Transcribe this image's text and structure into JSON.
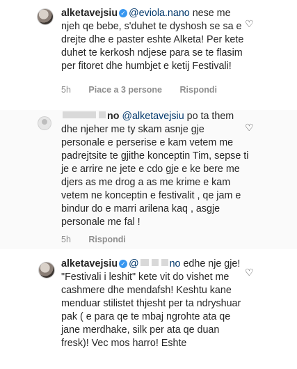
{
  "comments": [
    {
      "username": "alketavejsiu",
      "verified": true,
      "mention": "@eviola.nano",
      "text": " nese me njeh qe bebe, s'duhet te dyshosh se sa e drejte dhe e paster eshte Alketa! Per kete duhet te kerkosh ndjese para se te flasim per fitoret dhe humbjet e ketij Festivali!",
      "time": "5h",
      "likes": "Piace a 3 persone",
      "reply": "Rispondi"
    },
    {
      "username_visible": "no",
      "mention": "@alketavejsiu",
      "text": " po ta them dhe njeher me ty skam asnje gje personale e perserise e kam vetem me padrejtsite  te gjithe konceptin Tim,  sepse ti je e arrire ne jete e cdo gje e ke bere me djers as me drog a as me krime e kam vetem ne konceptin  e festivalit , qe jam e bindur do e marri arilena kaq , asgje personale me fal !",
      "time": "5h",
      "reply": "Rispondi"
    },
    {
      "username": "alketavejsiu",
      "verified": true,
      "mention_visible": "@",
      "mention_tail": "no",
      "text": " edhe nje gje! \"Festivali i leshit\" kete vit do vishet me  cashmere dhe mendafsh! Keshtu kane menduar stilistet thjesht per ta ndryshuar pak ( e para qe te mbaj ngrohte ata qe jane merdhake, silk per ata qe duan fresk)! Vec mos harro! Eshte"
    }
  ],
  "icons": {
    "like": "heart-outline-icon",
    "verified": "verified-badge-icon"
  },
  "colors": {
    "text": "#262626",
    "meta": "#8e8e8e",
    "mention": "#00376b",
    "verified": "#3897f0",
    "highlight_bg": "#fafafa"
  }
}
